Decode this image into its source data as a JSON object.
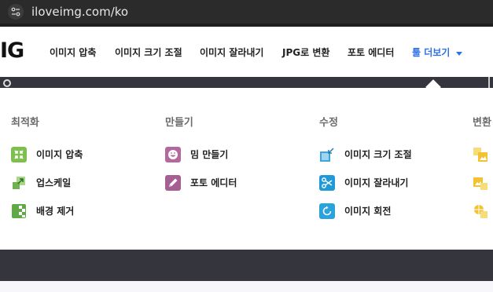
{
  "browser": {
    "url": "iloveimg.com/ko"
  },
  "header": {
    "logo_fragment": "IG",
    "nav": [
      {
        "label": "이미지 압축"
      },
      {
        "label": "이미지 크기 조절"
      },
      {
        "label": "이미지 잘라내기"
      },
      {
        "label": "JPG로 변환"
      },
      {
        "label": "포토 에디터"
      },
      {
        "label": "툴 더보기"
      }
    ]
  },
  "dropdown": {
    "columns": [
      {
        "title": "최적화",
        "items": [
          {
            "label": "이미지 압축",
            "icon": "compress-icon",
            "color": "#7fbf4f"
          },
          {
            "label": "업스케일",
            "icon": "upscale-icon",
            "color": "#6fb24f"
          },
          {
            "label": "배경 제거",
            "icon": "remove-background-icon",
            "color": "#5faa45"
          }
        ]
      },
      {
        "title": "만들기",
        "items": [
          {
            "label": "밈 만들기",
            "icon": "meme-icon",
            "color": "#b3689f"
          },
          {
            "label": "포토 에디터",
            "icon": "pencil-icon",
            "color": "#a65f93"
          }
        ]
      },
      {
        "title": "수정",
        "items": [
          {
            "label": "이미지 크기 조절",
            "icon": "resize-icon",
            "color": "#3aa6dd"
          },
          {
            "label": "이미지 잘라내기",
            "icon": "crop-icon",
            "color": "#1f9ad6"
          },
          {
            "label": "이미지 회전",
            "icon": "rotate-icon",
            "color": "#2aa3dc"
          }
        ]
      },
      {
        "title": "변환",
        "items": [
          {
            "icon": "convert-to-jpg-icon",
            "color": "#f2c230"
          },
          {
            "icon": "convert-from-jpg-icon",
            "color": "#f2c230"
          },
          {
            "icon": "html-to-image-icon",
            "color": "#f2c230"
          }
        ]
      }
    ]
  },
  "colors": {
    "accent": "#2e70e8",
    "dark_band": "#35353d"
  }
}
